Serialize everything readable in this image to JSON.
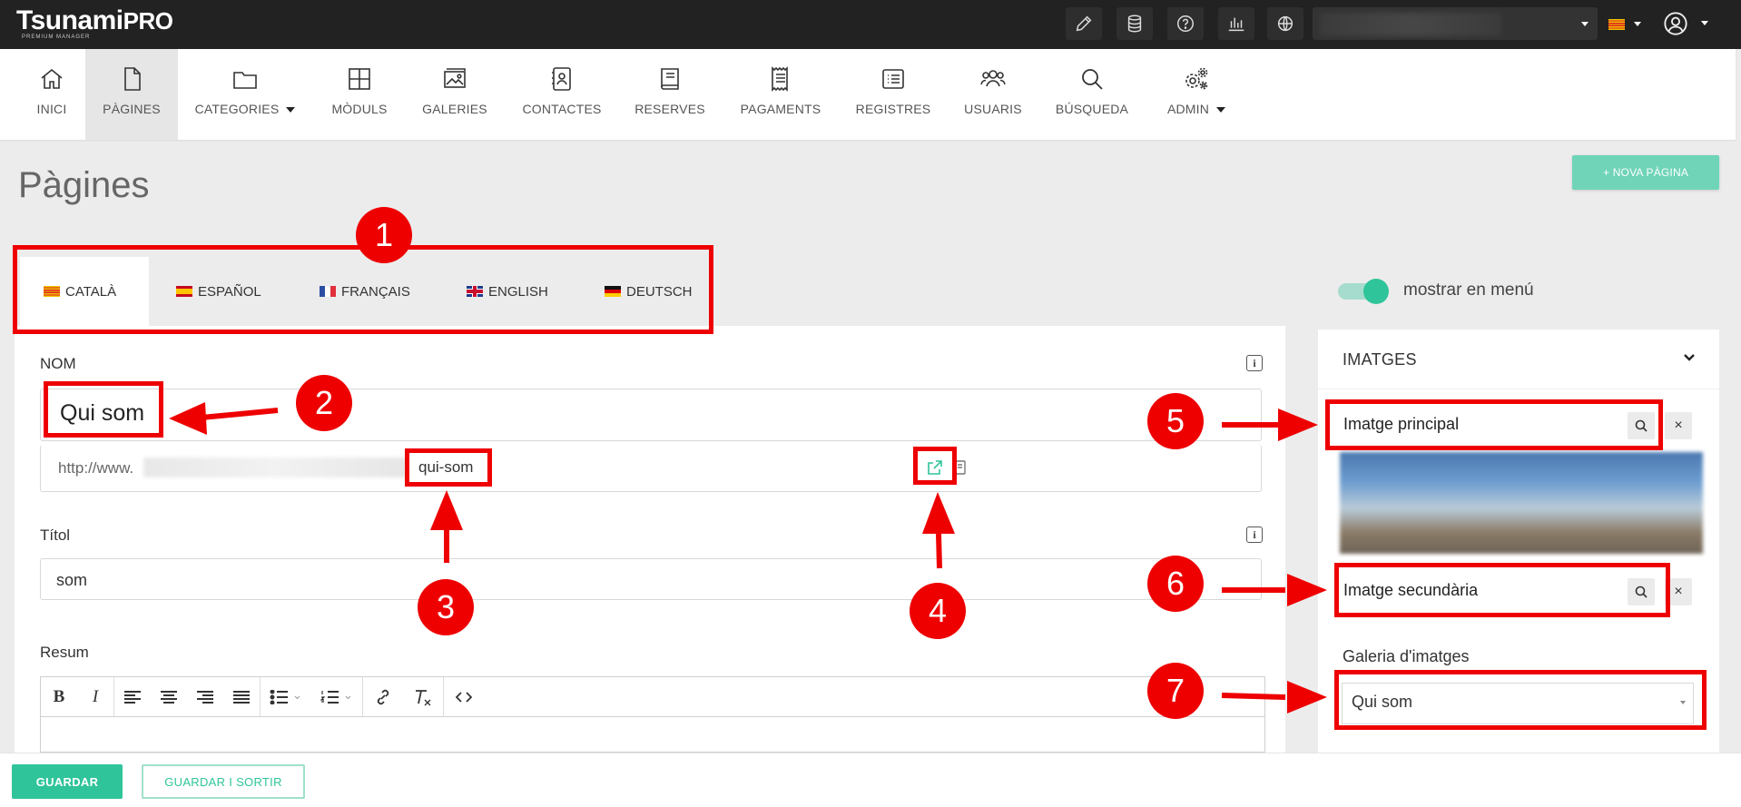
{
  "app": {
    "logo_main": "Tsunami",
    "logo_pro": "PRO",
    "logo_sub": "PREMIUM MANAGER"
  },
  "topbar": {
    "icons": [
      "pencil-icon",
      "database-icon",
      "help-icon",
      "stats-icon",
      "globe-icon"
    ],
    "site_select_value": ""
  },
  "nav": {
    "items": [
      {
        "label": "INICI",
        "icon": "home-icon"
      },
      {
        "label": "PÀGINES",
        "icon": "page-icon"
      },
      {
        "label": "CATEGORIES",
        "icon": "folder-icon"
      },
      {
        "label": "MÒDULS",
        "icon": "modules-icon"
      },
      {
        "label": "GALERIES",
        "icon": "gallery-icon"
      },
      {
        "label": "CONTACTES",
        "icon": "contacts-icon"
      },
      {
        "label": "RESERVES",
        "icon": "book-icon"
      },
      {
        "label": "PAGAMENTS",
        "icon": "receipt-icon"
      },
      {
        "label": "REGISTRES",
        "icon": "list-icon"
      },
      {
        "label": "USUARIS",
        "icon": "users-icon"
      },
      {
        "label": "BÚSQUEDA",
        "icon": "search-icon"
      },
      {
        "label": "ADMIN",
        "icon": "gears-icon"
      }
    ],
    "active": "PÀGINES"
  },
  "page": {
    "title": "Pàgines",
    "new_button": "+ NOVA PÀGINA"
  },
  "languages": {
    "tabs": [
      {
        "label": "CATALÀ"
      },
      {
        "label": "ESPAÑOL"
      },
      {
        "label": "FRANÇAIS"
      },
      {
        "label": "ENGLISH"
      },
      {
        "label": "DEUTSCH"
      }
    ],
    "active": "CATALÀ"
  },
  "form": {
    "nom_label": "NOM",
    "nom_value": "Qui som",
    "url_prefix": "http://www.",
    "url_slug": "qui-som",
    "titol_label": "Títol",
    "titol_value": "som",
    "resum_label": "Resum",
    "info_glyph": "i"
  },
  "editor": {
    "tools": [
      "bold",
      "italic",
      "align-left",
      "align-center",
      "align-right",
      "justify",
      "bullet-list",
      "numbered-list",
      "link",
      "clear-format",
      "source-code"
    ]
  },
  "sidebar": {
    "toggle_label": "mostrar en menú",
    "toggle_on": true,
    "section_title": "IMATGES",
    "main_image_label": "Imatge principal",
    "secondary_image_label": "Imatge secundària",
    "gallery_label": "Galeria d'imatges",
    "gallery_value": "Qui som",
    "remove_glyph": "×"
  },
  "footer": {
    "save": "GUARDAR",
    "save_exit": "GUARDAR I SORTIR"
  },
  "annotations": {
    "markers": [
      "1",
      "2",
      "3",
      "4",
      "5",
      "6",
      "7"
    ]
  },
  "colors": {
    "accent": "#2fc49a",
    "accent_light": "#6fd4b8",
    "annotation_red": "#ee0000",
    "topbar": "#222222"
  }
}
